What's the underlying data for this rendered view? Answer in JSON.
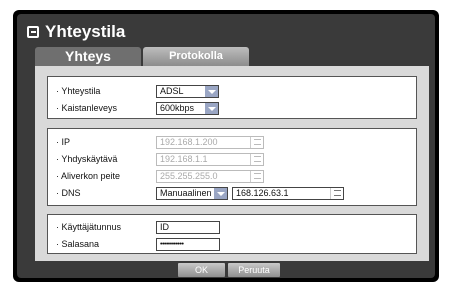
{
  "dialog": {
    "title": "Yhteystila",
    "tabs": [
      {
        "label": "Yhteys"
      },
      {
        "label": "Protokolla"
      }
    ]
  },
  "connection": {
    "mode_label": "· Yhteystila",
    "mode_value": "ADSL",
    "bandwidth_label": "· Kaistanleveys",
    "bandwidth_value": "600kbps"
  },
  "network": {
    "ip_label": "· IP",
    "ip_value": "192.168.1.200",
    "gateway_label": "· Yhdyskäytävä",
    "gateway_value": "192.168.1.1",
    "subnet_label": "· Aliverkon peite",
    "subnet_value": "255.255.255.0",
    "dns_label": "· DNS",
    "dns_mode_value": "Manuaalinen",
    "dns_value": "168.126.63.1"
  },
  "account": {
    "user_label": "· Käyttäjätunnus",
    "user_value": "ID",
    "password_label": "· Salasana",
    "password_value": "••••••••••••"
  },
  "buttons": {
    "ok_label": "OK",
    "cancel_label": "Peruuta"
  }
}
